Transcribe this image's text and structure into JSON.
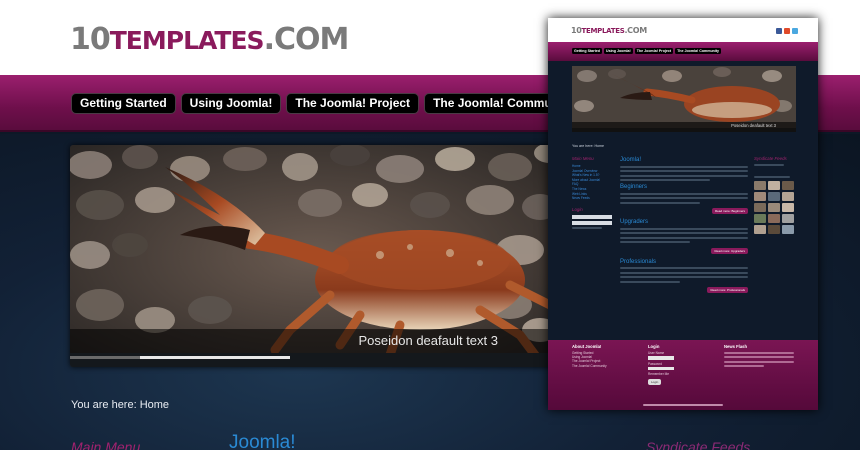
{
  "site": {
    "logo": {
      "num": "10",
      "word": "TEMPLATES",
      "tld": ".COM"
    },
    "nav": [
      "Getting Started",
      "Using Joomla!",
      "The Joomla! Project",
      "The Joomla! Community"
    ],
    "slideshow": {
      "caption": "Poseidon deafault text 3"
    },
    "breadcrumb": "You are here: Home",
    "headings": {
      "main_menu": "Main Menu",
      "joomla": "Joomla!",
      "syndicate": "Syndicate Feeds"
    }
  },
  "preview": {
    "logo": {
      "num": "10",
      "word": "TEMPLATES",
      "tld": ".COM"
    },
    "nav": [
      "Getting Started",
      "Using Joomla!",
      "The Joomla! Project",
      "The Joomla! Community"
    ],
    "caption": "Poseidon deafault text 3",
    "breadcrumb": "You are here: Home",
    "main_menu": "Main Menu",
    "menu_items": [
      "Home",
      "Joomla! Overview",
      "What's New in 1.5?",
      "More about Joomla!",
      "FAQ",
      "The News",
      "Web Links",
      "News Feeds"
    ],
    "joomla_heading": "Joomla!",
    "beginners": "Beginners",
    "upgraders": "Upgraders",
    "professionals": "Professionals",
    "read_more_beginners": "Read more: Beginners",
    "read_more_upgraders": "Read more: Upgraders",
    "read_more_professionals": "Read more: Professionals",
    "login_heading": "Login",
    "syndicate": "Syndicate Feeds",
    "footer_about": "About Joomla!",
    "footer_login": "Login",
    "footer_news": "News Flash",
    "footer_username": "User Name",
    "footer_password": "Password",
    "footer_remember": "Remember Me",
    "footer_login_btn": "Login"
  },
  "colors": {
    "brand_magenta": "#8a1a5c",
    "accent_blue": "#2a8ad4",
    "nav_bg": "#000000"
  }
}
